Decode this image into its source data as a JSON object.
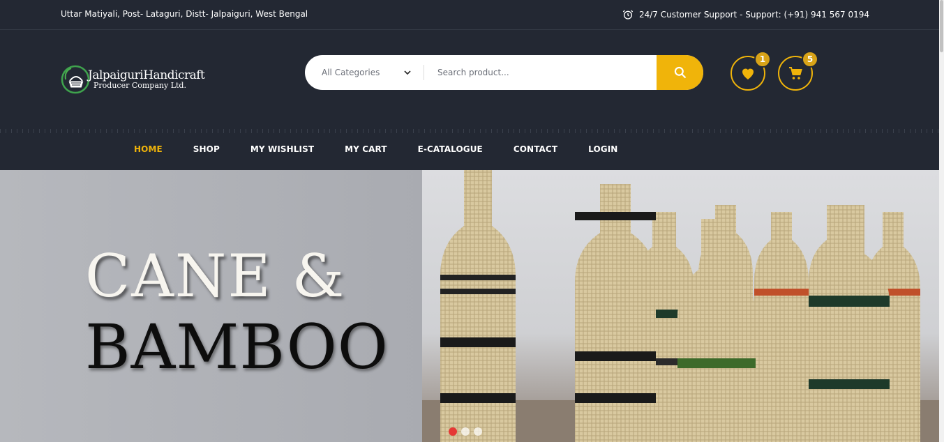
{
  "topbar": {
    "address": "Uttar Matiyali, Post- Lataguri, Distt- Jalpaiguri, West Bengal",
    "support": "24/7 Customer Support - Support: (+91) 941 567 0194",
    "support_icon": "alarm-clock-icon"
  },
  "logo": {
    "line1": "JalpaiguriHandicraft",
    "line2": "Producer Company Ltd."
  },
  "search": {
    "category_selected": "All Categories",
    "placeholder": "Search product...",
    "button_icon": "search-icon"
  },
  "header_icons": {
    "wishlist_count": "1",
    "cart_count": "5"
  },
  "nav": {
    "items": [
      {
        "label": "HOME"
      },
      {
        "label": "SHOP"
      },
      {
        "label": "MY WISHLIST"
      },
      {
        "label": "MY CART"
      },
      {
        "label": "E-CATALOGUE"
      },
      {
        "label": "CONTACT"
      },
      {
        "label": "LOGIN"
      }
    ],
    "active": "HOME"
  },
  "hero": {
    "line1": "CANE &",
    "line2": "BAMBOO",
    "slides": 3,
    "active_slide": 1
  },
  "colors": {
    "dark_bg": "#232833",
    "accent": "#f0b40a",
    "active_dot": "#e53935"
  }
}
